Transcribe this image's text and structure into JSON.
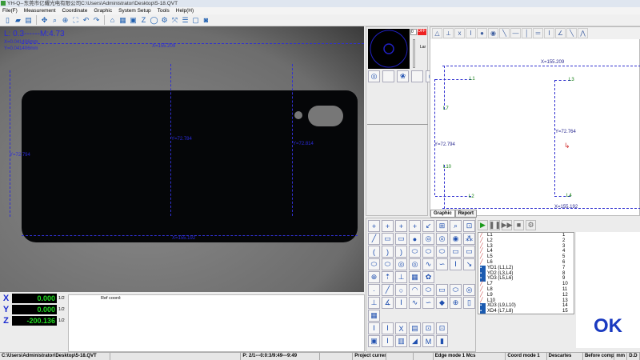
{
  "window": {
    "title": "YH-Q--东莞市亿耀光电有限公司C:\\Users\\Administrator\\Desktop\\5-18.QVT"
  },
  "menu": [
    "File(F)",
    "Measurement",
    "Coordinate",
    "Graphic",
    "System Setup",
    "Tools",
    "Help(H)"
  ],
  "toolbar": [
    "new-file-icon",
    "open-folder-icon",
    "save-icon",
    "|",
    "move-icon",
    "zoom-region-icon",
    "crosshair-icon",
    "fit-icon",
    "undo-icon",
    "redo-icon",
    "|",
    "home-icon",
    "grid-icon",
    "image-icon",
    "z-axis-icon",
    "circle-icon",
    "gear-icon",
    "expand-icon",
    "list-icon",
    "window-icon",
    "camera-icon"
  ],
  "camera": {
    "lens_readout": "L: 0.3------M:4.73",
    "pixel_x": "X=0.041406mm",
    "pixel_y": "Y=0.041406mm",
    "dims": {
      "x_top": "X=155.209",
      "x_bottom": "X=155.192",
      "y_left": "Y=72.794",
      "y_center": "Y=72.784",
      "y_right": "Y=72.814"
    }
  },
  "mini": {
    "value": "0",
    "off": "OFF",
    "lamp": "Lar"
  },
  "graphic": {
    "tools": [
      "angle-icon",
      "distance-icon",
      "x-dist-icon",
      "y-dist-icon",
      "circle-icon",
      "circle2-icon",
      "line-diag-icon",
      "line-h-icon",
      "line-v-icon",
      "parallel-icon",
      "height-icon",
      "angle2-icon",
      "line-red-icon",
      "symmetry-icon"
    ],
    "dims": {
      "x_top": "X=155.209",
      "x_bottom": "X=155.192",
      "y_left": "Y=72.794",
      "y_right": "Y=72.764"
    },
    "labels": [
      "L1",
      "L3",
      "L7",
      "L10",
      "L2",
      "L4"
    ],
    "tabs": [
      "Graphic",
      "Report"
    ]
  },
  "palette": [
    "point-cross",
    "point-cross2",
    "point-cross3",
    "point-cross4",
    "line-arrow",
    "box-point",
    "zoom-icon",
    "user-icon",
    "line",
    "rect-slot",
    "rect-slot2",
    "circle",
    "ring",
    "ring2",
    "circle-dot",
    "circles",
    "arc",
    "arc2",
    "arc3",
    "ellipse",
    "ellipse2",
    "ellipse3",
    "rect",
    "rect2",
    "ellipse-pts",
    "ellipse-pts2",
    "circle-pts",
    "circle-pts2",
    "curve",
    "blob",
    "height",
    "angle-line",
    "circle-plus",
    "arrows-up",
    "cylinder",
    "calculator",
    "gear-gray",
    "",
    "",
    "",
    "dot",
    "line2",
    "circle3",
    "arc4",
    "ellipse4",
    "rect3",
    "slot",
    "ring3",
    "distance",
    "angle3",
    "height2",
    "curve2",
    "blob2",
    "layers",
    "globe",
    "cylinder2",
    "calculator2",
    "",
    "",
    "",
    "",
    "",
    "",
    "",
    "coord-o",
    "coord-s",
    "excel",
    "report",
    "box-plus",
    "box-dash",
    "",
    "",
    "box-save",
    "coord-c",
    "excel-chart",
    "eraser",
    "mp",
    "color-bars",
    "",
    ""
  ],
  "run": [
    "play-icon",
    "pause-icon",
    "step-icon",
    "stop-icon",
    "settings-icon"
  ],
  "elements": [
    {
      "name": "L1",
      "no": "1",
      "type": "line"
    },
    {
      "name": "L2",
      "no": "2",
      "type": "line"
    },
    {
      "name": "L3",
      "no": "3",
      "type": "line"
    },
    {
      "name": "L4",
      "no": "4",
      "type": "line"
    },
    {
      "name": "L5",
      "no": "5",
      "type": "line"
    },
    {
      "name": "L6",
      "no": "6",
      "type": "line"
    },
    {
      "name": "YD1 (L1,L2)",
      "no": "7",
      "type": "dist"
    },
    {
      "name": "YD2 (L3,L4)",
      "no": "8",
      "type": "dist"
    },
    {
      "name": "YD3 (L5,L6)",
      "no": "9",
      "type": "dist"
    },
    {
      "name": "L7",
      "no": "10",
      "type": "line"
    },
    {
      "name": "L8",
      "no": "11",
      "type": "line"
    },
    {
      "name": "L9",
      "no": "12",
      "type": "line"
    },
    {
      "name": "L10",
      "no": "13",
      "type": "line"
    },
    {
      "name": "XD3 (L9,L10)",
      "no": "14",
      "type": "dist"
    },
    {
      "name": "XD4 (L7,L8)",
      "no": "15",
      "type": "dist"
    }
  ],
  "ok_label": "OK",
  "coords": [
    {
      "axis": "X",
      "value": "0.000",
      "half": "1/2"
    },
    {
      "axis": "Y",
      "value": "0.000",
      "half": "1/2"
    },
    {
      "axis": "Z",
      "value": "-200.136",
      "half": "1/2"
    }
  ],
  "ref_coord": "Ref coord:",
  "status": [
    "C:\\Users\\Administrator\\Desktop\\5-18.QVT",
    "",
    "P: 2/1---0:0:3/9:49---9:49",
    "",
    "Project current heig",
    "",
    "",
    "Edge mode 1 Mcs",
    "Coord mode 1",
    "Descartes",
    "Before comp c",
    "mm",
    "D.D"
  ],
  "colors": {
    "dimension": "#3030d0",
    "graphic_label": "#0a7a0a",
    "coord_value": "#22dd22",
    "ok": "#1a3ac0"
  }
}
